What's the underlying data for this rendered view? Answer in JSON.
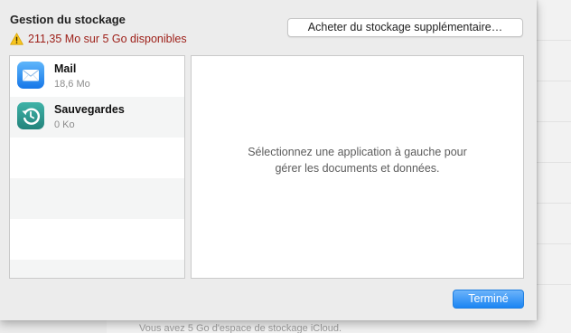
{
  "dialog": {
    "title": "Gestion du stockage",
    "warning_text": "211,35 Mo sur 5 Go disponibles",
    "buy_button_label": "Acheter du stockage supplémentaire…",
    "done_button_label": "Terminé"
  },
  "apps": [
    {
      "name": "Mail",
      "size": "18,6 Mo",
      "icon": "mail-icon"
    },
    {
      "name": "Sauvegardes",
      "size": "0 Ko",
      "icon": "backup-icon"
    }
  ],
  "detail": {
    "message": "Sélectionnez une application à gauche pour gérer les documents et données."
  },
  "background": {
    "footer_text": "Vous avez 5 Go d'espace de stockage iCloud."
  },
  "colors": {
    "warning_text": "#9d1e17",
    "accent_button": "#1b85f3",
    "mail_icon": "#2a8ef2",
    "backup_icon": "#2f9a92"
  }
}
